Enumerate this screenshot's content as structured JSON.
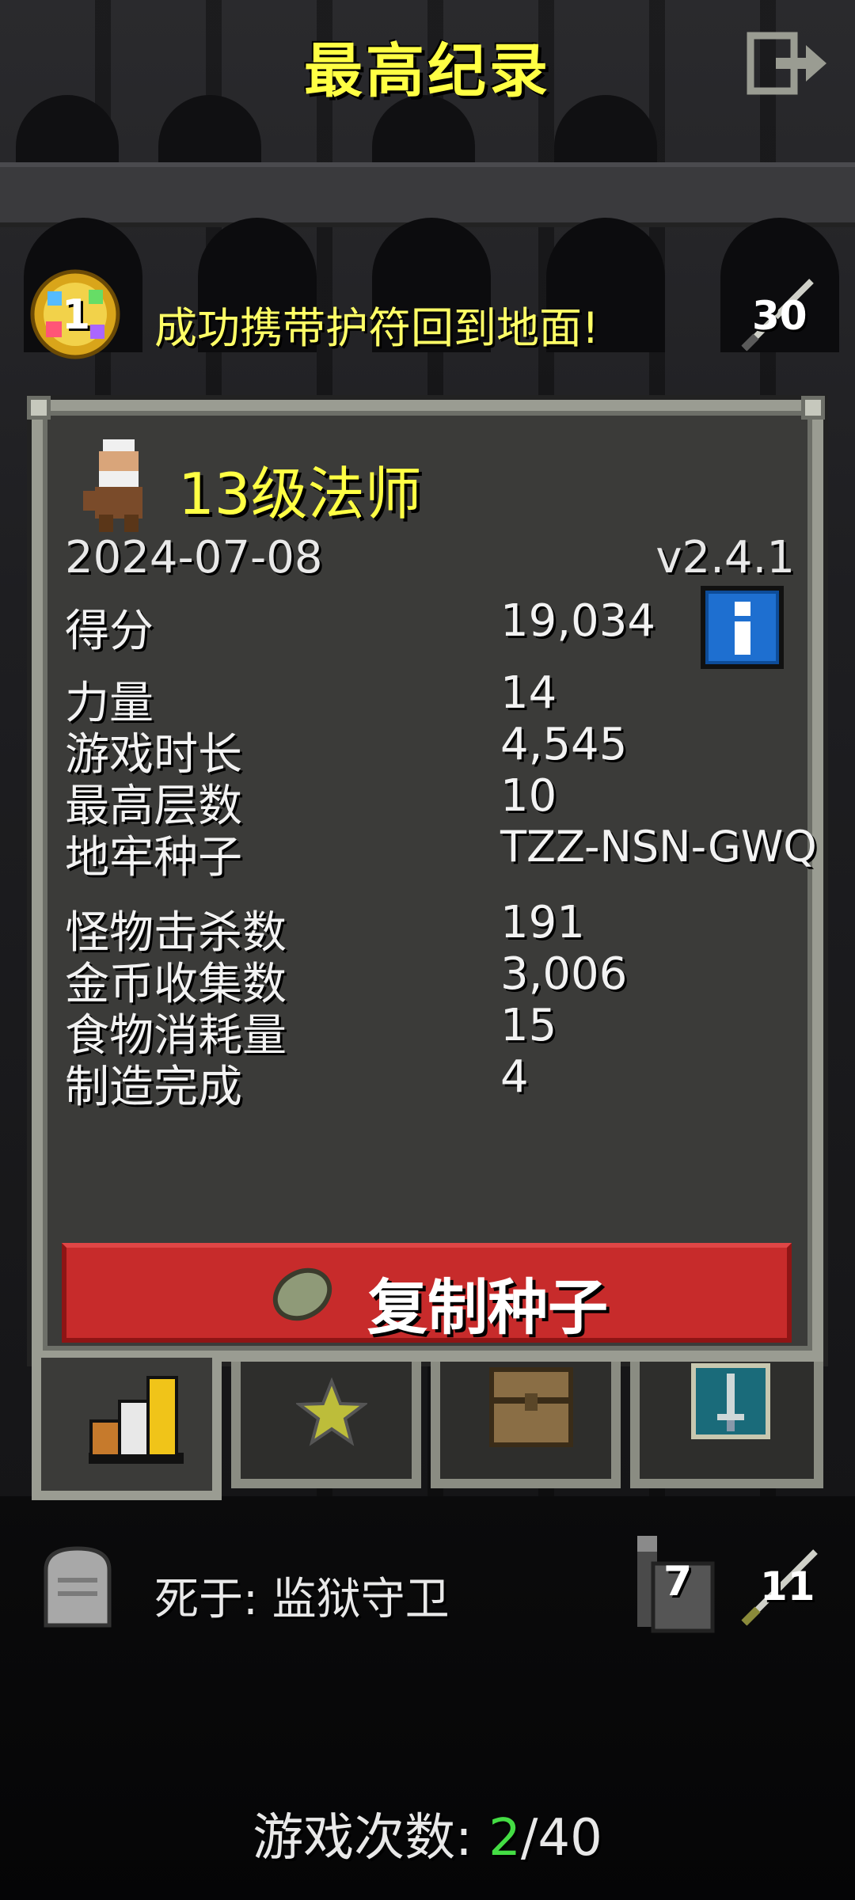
{
  "title": "最高纪录",
  "record": {
    "rank": "1",
    "text": "成功携带护符回到地面!",
    "depth_badge": "30"
  },
  "hero": {
    "title": "13级法师",
    "date": "2024-07-08",
    "version": "v2.4.1"
  },
  "stats": {
    "score_label": "得分",
    "score_value": "19,034",
    "strength_label": "力量",
    "strength_value": "14",
    "duration_label": "游戏时长",
    "duration_value": "4,545",
    "max_depth_label": "最高层数",
    "max_depth_value": "10",
    "seed_label": "地牢种子",
    "seed_value": "TZZ-NSN-GWQ",
    "kills_label": "怪物击杀数",
    "kills_value": "191",
    "gold_label": "金币收集数",
    "gold_value": "3,006",
    "food_label": "食物消耗量",
    "food_value": "15",
    "crafted_label": "制造完成",
    "crafted_value": "4"
  },
  "copy_seed_label": "复制种子",
  "tabs": [
    {
      "icon": "stats-bars-icon",
      "active": true
    },
    {
      "icon": "badge-star-icon",
      "active": false
    },
    {
      "icon": "chest-icon",
      "active": false
    },
    {
      "icon": "sword-scroll-icon",
      "active": false
    }
  ],
  "death": {
    "text": "死于:  监狱守卫",
    "depth": "7",
    "level": "11"
  },
  "games": {
    "label": "游戏次数: ",
    "current": "2",
    "total": "/40"
  },
  "colors": {
    "title_yellow": "#ffff44",
    "panel_bg": "#3b3b39",
    "panel_border": "#9a9c92",
    "button_red": "#c72b2b",
    "games_green": "#44dd44"
  }
}
